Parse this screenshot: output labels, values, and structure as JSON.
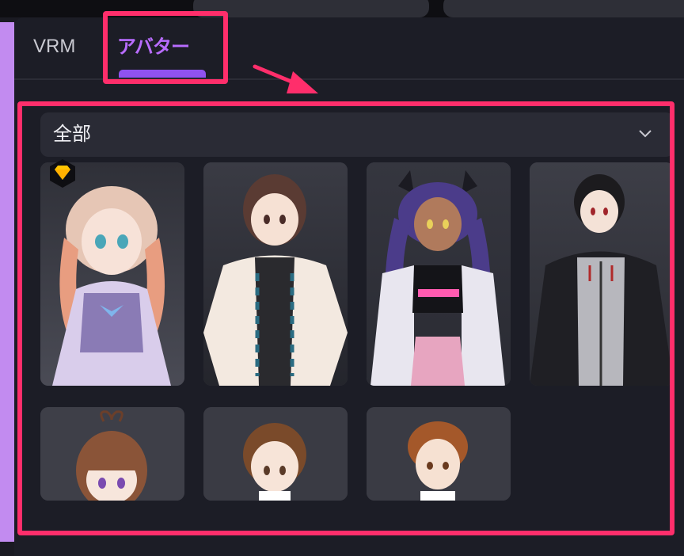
{
  "tabs": [
    {
      "label": "VRM",
      "active": false
    },
    {
      "label": "アバター",
      "active": true
    }
  ],
  "filter": {
    "selected": "全部"
  },
  "colors": {
    "accent": "#b86cff",
    "highlight": "#ff2e6b",
    "panel": "#1c1d26",
    "premium": "#ffc400"
  },
  "avatars": [
    {
      "name": "avatar-pink-hair",
      "premium": true
    },
    {
      "name": "avatar-brown-bob",
      "premium": false
    },
    {
      "name": "avatar-purple-twintail",
      "premium": false
    },
    {
      "name": "avatar-black-hoodie",
      "premium": false
    },
    {
      "name": "avatar-heart-hair",
      "premium": false
    },
    {
      "name": "avatar-brown-short",
      "premium": false
    },
    {
      "name": "avatar-boy-brown",
      "premium": false
    }
  ]
}
